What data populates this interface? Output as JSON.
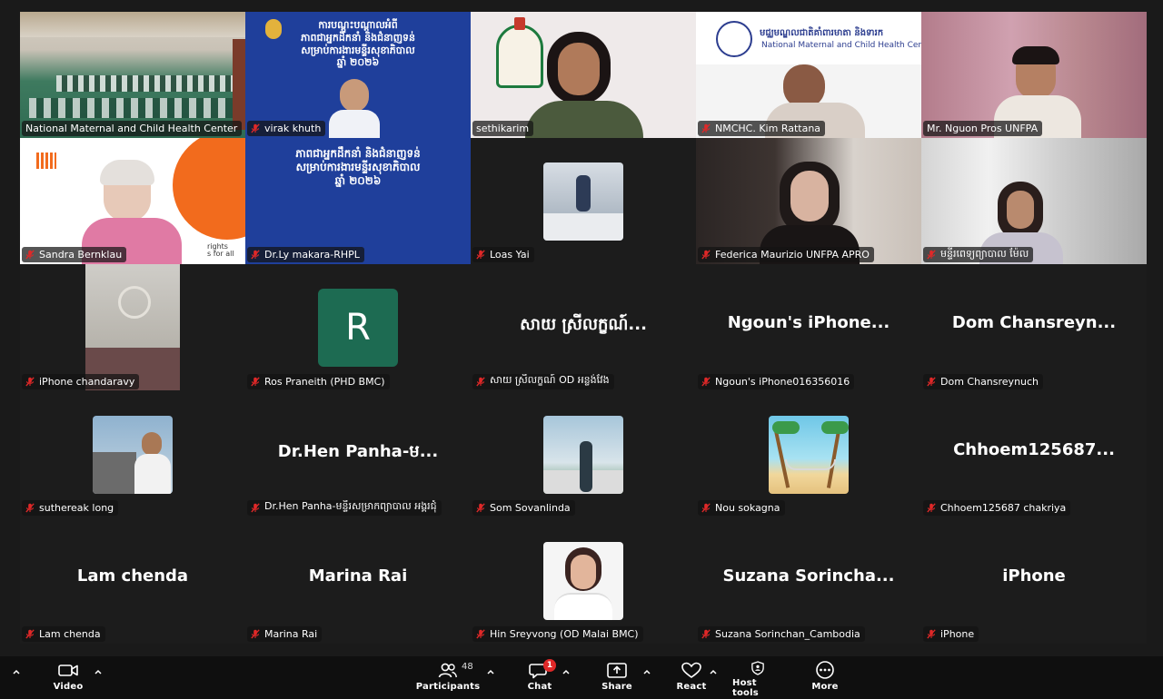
{
  "participants_grid": [
    {
      "name": "National Maternal and Child Health Center",
      "muted": false,
      "kind": "conference-room"
    },
    {
      "name": "virak khuth",
      "muted": true,
      "kind": "slide-video",
      "slide_lines": [
        "ការបណ្តុះបណ្តាលអំពី",
        "ភាពជាអ្នកដឹកនាំ និងជំនាញទន់",
        "សម្រាប់ការងារមន្ទីរសុខាភិបាល",
        "ឆ្នាំ ២០២៦"
      ]
    },
    {
      "name": "sethikarim",
      "muted": false,
      "kind": "speaker",
      "active": true
    },
    {
      "name": "NMCHC. Kim Rattana",
      "muted": true,
      "kind": "nmchc-banner",
      "banner_khmer": "មជ្ឈមណ្ឌលជាតិគាំពារមាតា និងទារក",
      "banner_english": "National Maternal and Child Health Center"
    },
    {
      "name": "Mr. Nguon Pros UNFPA",
      "muted": false,
      "kind": "video-pink"
    },
    {
      "name": "Sandra Bernklau",
      "muted": true,
      "kind": "unfpa-bg",
      "bg_text": "rights\ns for all"
    },
    {
      "name": "Dr.Ly makara-RHPL",
      "muted": true,
      "kind": "slide-only",
      "slide_lines": [
        "ភាពជាអ្នកដឹកនាំ និងជំនាញទន់",
        "សម្រាប់ការងារមន្ទីរសុខាភិបាល",
        "ឆ្នាំ ២០២៦"
      ]
    },
    {
      "name": "Loas Yai",
      "muted": true,
      "kind": "thumb-lab"
    },
    {
      "name": "Federica Maurizio UNFPA APRO",
      "muted": true,
      "kind": "video-room"
    },
    {
      "name": "មន្ទីរពេទ្យព្យាបាល ម៉ែល",
      "muted": true,
      "kind": "video-curtain"
    },
    {
      "name": "iPhone chandaravy",
      "muted": true,
      "kind": "video-fan"
    },
    {
      "name": "Ros Praneith (PHD BMC)",
      "muted": true,
      "kind": "avatar-letter",
      "avatar_letter": "R"
    },
    {
      "name": "សាយ ស្រីលក្ខណ៍ OD អន្លង់វែង",
      "muted": true,
      "kind": "big-name",
      "big_name": "សាយ ស្រីលក្ខណ៍..."
    },
    {
      "name": "Ngoun's iPhone016356016",
      "muted": true,
      "kind": "big-name",
      "big_name": "Ngoun's iPhone..."
    },
    {
      "name": "Dom Chansreynuch",
      "muted": true,
      "kind": "big-name",
      "big_name": "Dom Chansreyn..."
    },
    {
      "name": "suthereak long",
      "muted": true,
      "kind": "thumb-selfie"
    },
    {
      "name": "Dr.Hen Panha-មន្ទីរសម្រាកព្យាបាល អង្គរជុំ",
      "muted": true,
      "kind": "big-name",
      "big_name": "Dr.Hen Panha-ម..."
    },
    {
      "name": "Som Sovanlinda",
      "muted": true,
      "kind": "thumb-outdoor"
    },
    {
      "name": "Nou sokagna",
      "muted": true,
      "kind": "thumb-beach"
    },
    {
      "name": "Chhoem125687 chakriya",
      "muted": true,
      "kind": "big-name",
      "big_name": "Chhoem125687..."
    },
    {
      "name": "Lam chenda",
      "muted": true,
      "kind": "big-name",
      "big_name": "Lam chenda"
    },
    {
      "name": "Marina Rai",
      "muted": true,
      "kind": "big-name",
      "big_name": "Marina Rai"
    },
    {
      "name": "Hin Sreyvong (OD Malai BMC)",
      "muted": true,
      "kind": "thumb-portrait"
    },
    {
      "name": "Suzana Sorinchan_Cambodia",
      "muted": true,
      "kind": "big-name",
      "big_name": "Suzana Sorincha..."
    },
    {
      "name": "iPhone",
      "muted": true,
      "kind": "big-name",
      "big_name": "iPhone"
    }
  ],
  "toolbar": {
    "video_label": "Video",
    "participants_label": "Participants",
    "participants_count": "48",
    "chat_label": "Chat",
    "chat_badge": "1",
    "share_label": "Share",
    "react_label": "React",
    "host_tools_label": "Host tools",
    "more_label": "More"
  },
  "colors": {
    "active_speaker_border": "#23d959",
    "muted_icon": "#e02828",
    "background": "#1a1a1a",
    "slide_blue": "#1f3f9b"
  }
}
